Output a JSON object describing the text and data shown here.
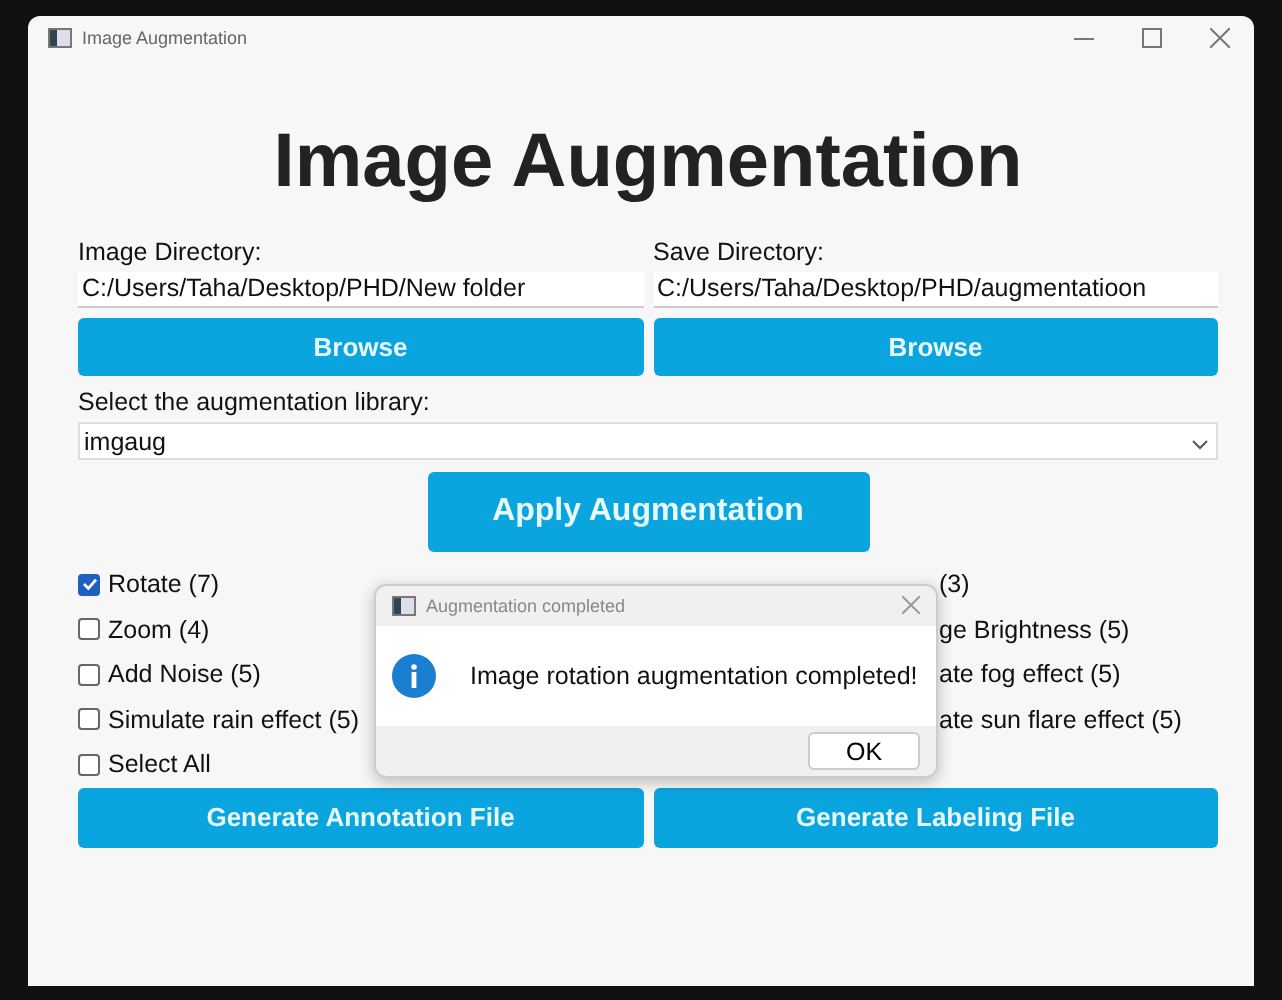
{
  "window": {
    "title": "Image Augmentation"
  },
  "heading": "Image Augmentation",
  "directories": [
    {
      "label": "Image Directory:",
      "value": "C:/Users/Taha/Desktop/PHD/New folder",
      "button": "Browse"
    },
    {
      "label": "Save Directory:",
      "value": "C:/Users/Taha/Desktop/PHD/augmentatioon",
      "button": "Browse"
    }
  ],
  "library": {
    "label": "Select the augmentation library:",
    "value": "imgaug"
  },
  "apply_button": "Apply Augmentation",
  "options_left": [
    {
      "label": "Rotate (7)",
      "checked": true
    },
    {
      "label": "Zoom (4)",
      "checked": false
    },
    {
      "label": "Add Noise (5)",
      "checked": false
    },
    {
      "label": "Simulate rain effect (5)",
      "checked": false
    },
    {
      "label": "Select All",
      "checked": false
    }
  ],
  "options_right": [
    {
      "label": "(3)"
    },
    {
      "label": "ge Brightness (5)"
    },
    {
      "label": "ate fog effect (5)"
    },
    {
      "label": "ate sun flare effect (5)"
    }
  ],
  "bottom_buttons": [
    "Generate Annotation File",
    "Generate Labeling File"
  ],
  "dialog": {
    "title": "Augmentation completed",
    "message": "Image rotation augmentation completed!",
    "button": "OK"
  }
}
